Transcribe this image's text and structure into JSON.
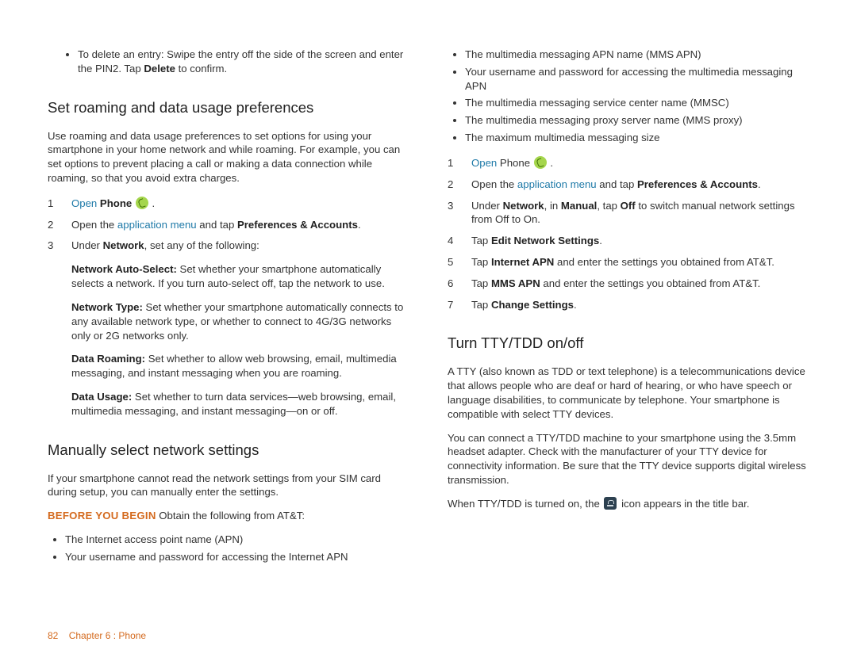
{
  "footer": {
    "page_num": "82",
    "chapter": "Chapter 6 : Phone"
  },
  "left": {
    "bullet_delete": {
      "pre": "To delete an entry: Swipe the entry off the side of the screen and enter the PIN2. Tap ",
      "bold": "Delete",
      "post": " to confirm."
    },
    "h_roaming": "Set roaming and data usage preferences",
    "roaming_intro": "Use roaming and data usage preferences to set options for using your smartphone in your home network and while roaming. For example, you can set options to prevent placing a call or making a data connection while roaming, so that you avoid extra charges.",
    "step1_open": "Open",
    "step1_phone": " Phone ",
    "step2_pre": "Open the ",
    "step2_link": "application menu",
    "step2_mid": " and tap ",
    "step2_bold": "Preferences & Accounts",
    "step3_pre": "Under ",
    "step3_b": "Network",
    "step3_post": ", set any of the following:",
    "nas_lbl": "Network Auto-Select:",
    "nas_txt": " Set whether your smartphone automatically selects a network. If you turn auto-select off, tap the network to use.",
    "nt_lbl": "Network Type:",
    "nt_txt": " Set whether your smartphone automatically connects to any available network type, or whether to connect to 4G/3G networks only or 2G networks only.",
    "dr_lbl": "Data Roaming:",
    "dr_txt": " Set whether to allow web browsing, email, multimedia messaging, and instant messaging when you are roaming.",
    "du_lbl": "Data Usage:",
    "du_txt": " Set whether to turn data services—web browsing, email, multimedia messaging, and instant messaging—on or off.",
    "h_manual": "Manually select network settings",
    "manual_intro": "If your smartphone cannot read the network settings from your SIM card during setup, you can manually enter the settings.",
    "byb_label": "BEFORE YOU BEGIN",
    "byb_txt": "  Obtain the following from AT&T:",
    "b1": "The Internet access point name (APN)",
    "b2": "Your username and password for accessing the Internet APN"
  },
  "right": {
    "b3": "The multimedia messaging APN name (MMS APN)",
    "b4": "Your username and password for accessing the multimedia messaging APN",
    "b5": "The multimedia messaging service center name (MMSC)",
    "b6": "The multimedia messaging proxy server name (MMS proxy)",
    "b7": "The maximum multimedia messaging size",
    "s1_open": "Open",
    "s1_phone": " Phone ",
    "s2_pre": "Open the ",
    "s2_link": "application menu",
    "s2_mid": " and tap ",
    "s2_bold": "Preferences & Accounts",
    "s3_pre": "Under ",
    "s3_b1": "Network",
    "s3_mid1": ", in ",
    "s3_b2": "Manual",
    "s3_mid2": ", tap ",
    "s3_b3": "Off",
    "s3_post": " to switch manual network settings from Off to On.",
    "s4_pre": "Tap ",
    "s4_b": "Edit Network Settings",
    "s5_pre": "Tap ",
    "s5_b": "Internet APN",
    "s5_post": " and enter the settings you obtained from AT&T.",
    "s6_pre": "Tap ",
    "s6_b": "MMS APN",
    "s6_post": " and enter the settings you obtained from AT&T.",
    "s7_pre": "Tap ",
    "s7_b": "Change Settings",
    "h_tty": "Turn TTY/TDD on/off",
    "tty_p1": "A TTY (also known as TDD or text telephone) is a telecommunications device that allows people who are deaf or hard of hearing, or who have speech or language disabilities, to communicate by telephone. Your smartphone is compatible with select TTY devices.",
    "tty_p2": "You can connect a TTY/TDD machine to your smartphone using the 3.5mm headset adapter. Check with the manufacturer of your TTY device for connectivity information. Be sure that the TTY device supports digital wireless transmission.",
    "tty_p3_pre": "When TTY/TDD is turned on, the ",
    "tty_p3_post": " icon appears in the title bar."
  }
}
